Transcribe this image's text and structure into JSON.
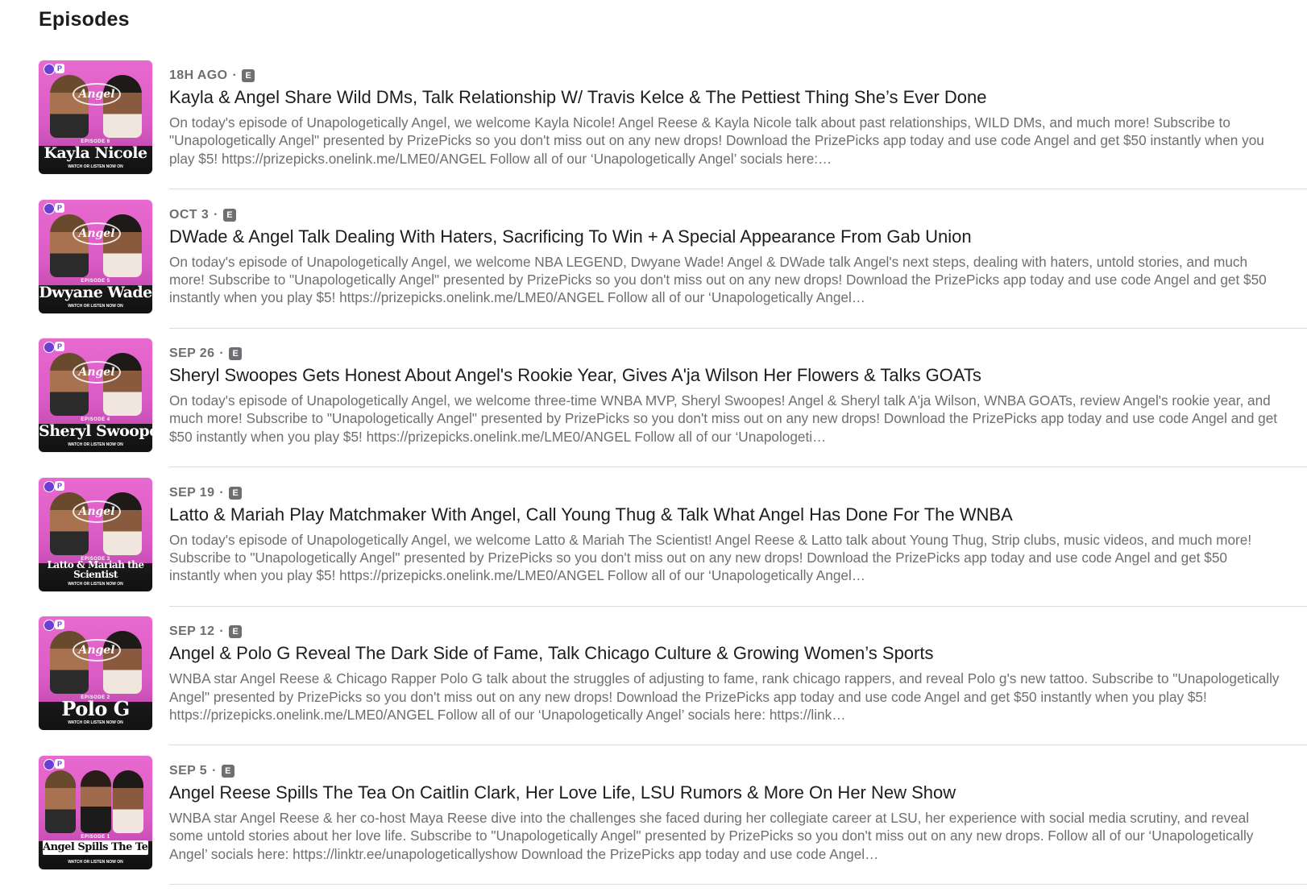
{
  "section": {
    "title": "Episodes"
  },
  "episodes": [
    {
      "date": "18H AGO",
      "explicit": "E",
      "title": "Kayla & Angel Share Wild DMs, Talk Relationship W/ Travis Kelce & The Pettiest Thing She’s Ever Done",
      "description": "On today's episode of Unapologetically Angel, we welcome Kayla Nicole! Angel Reese & Kayla Nicole talk about past relationships, WILD DMs, and much more! Subscribe to \"Unapologetically Angel\" presented by PrizePicks so you don't miss out on any new drops! Download the PrizePicks app today and use code Angel and get $50 instantly when you play $5! https://prizepicks.onelink.me/LME0/ANGEL Follow all of our ‘Unapologetically Angel’ socials here:…",
      "art": {
        "logo": "Angel",
        "episode_label": "EPISODE 6",
        "guest": "Kayla Nicole",
        "watch": "WATCH OR LISTEN NOW ON"
      }
    },
    {
      "date": "OCT 3",
      "explicit": "E",
      "title": "DWade & Angel Talk Dealing With Haters, Sacrificing To Win + A Special Appearance From Gab Union",
      "description": "On today's episode of Unapologetically Angel, we welcome NBA LEGEND, Dwyane Wade! Angel & DWade talk Angel's next steps, dealing with haters, untold stories, and much more! Subscribe to \"Unapologetically Angel\" presented by PrizePicks so you don't miss out on any new drops! Download the PrizePicks app today and use code Angel and get $50 instantly when you play $5! https://prizepicks.onelink.me/LME0/ANGEL Follow all of our ‘Unapologetically Angel…",
      "art": {
        "logo": "Angel",
        "episode_label": "EPISODE 5",
        "guest": "Dwyane Wade",
        "watch": "WATCH OR LISTEN NOW ON"
      }
    },
    {
      "date": "SEP 26",
      "explicit": "E",
      "title": "Sheryl Swoopes Gets Honest About Angel's Rookie Year, Gives A'ja Wilson Her Flowers & Talks GOATs",
      "description": "On today's episode of Unapologetically Angel, we welcome three-time WNBA MVP, Sheryl Swoopes! Angel & Sheryl talk A'ja Wilson, WNBA GOATs, review Angel's rookie year, and much more! Subscribe to \"Unapologetically Angel\" presented by PrizePicks so you don't miss out on any new drops! Download the PrizePicks app today and use code Angel and get $50 instantly when you play $5! https://prizepicks.onelink.me/LME0/ANGEL Follow all of our ‘Unapologeti…",
      "art": {
        "logo": "Angel",
        "episode_label": "EPISODE 4",
        "guest": "Sheryl Swoopes",
        "watch": "WATCH OR LISTEN NOW ON"
      }
    },
    {
      "date": "SEP 19",
      "explicit": "E",
      "title": "Latto & Mariah Play Matchmaker With Angel, Call Young Thug & Talk What Angel Has Done For The WNBA",
      "description": "On today's episode of Unapologetically Angel, we welcome Latto & Mariah The Scientist! Angel Reese & Latto talk about Young Thug, Strip clubs, music videos, and much more! Subscribe to \"Unapologetically Angel\" presented by PrizePicks so you don't miss out on any new drops! Download the PrizePicks app today and use code Angel and get $50 instantly when you play $5! https://prizepicks.onelink.me/LME0/ANGEL Follow all of our ‘Unapologetically Angel…",
      "art": {
        "logo": "Angel",
        "episode_label": "EPISODE 3",
        "guest": "Latto & Mariah the Scientist",
        "watch": "WATCH OR LISTEN NOW ON"
      }
    },
    {
      "date": "SEP 12",
      "explicit": "E",
      "title": "Angel & Polo G Reveal The Dark Side of Fame, Talk Chicago Culture & Growing Women’s Sports",
      "description": "WNBA star Angel Reese & Chicago Rapper Polo G talk about the struggles of adjusting to fame, rank chicago rappers, and reveal Polo g's new tattoo. Subscribe to \"Unapologetically Angel\" presented by PrizePicks so you don't miss out on any new drops! Download the PrizePicks app today and use code Angel and get $50 instantly when you play $5! https://prizepicks.onelink.me/LME0/ANGEL Follow all of our ‘Unapologetically Angel’ socials here: https://link…",
      "art": {
        "logo": "Angel",
        "episode_label": "EPISODE 2",
        "guest": "Polo G",
        "watch": "WATCH OR LISTEN NOW ON"
      }
    },
    {
      "date": "SEP 5",
      "explicit": "E",
      "title": "Angel Reese Spills The Tea On Caitlin Clark, Her Love Life, LSU Rumors & More On Her New Show",
      "description": "WNBA star Angel Reese & her co-host Maya Reese dive into the challenges she faced during her collegiate career at LSU, her experience with social media scrutiny, and reveal some untold stories about her love life. Subscribe to \"Unapologetically Angel\" presented by PrizePicks so you don't miss out on any new drops. Follow all of our ‘Unapologetically Angel’ socials here: https://linktr.ee/unapologeticallyshow Download the PrizePicks app today and use code Angel…",
      "art": {
        "logo": "",
        "episode_label": "EPISODE 1",
        "guest": "Angel Spills The Tea",
        "watch": "WATCH OR LISTEN NOW ON"
      }
    }
  ]
}
